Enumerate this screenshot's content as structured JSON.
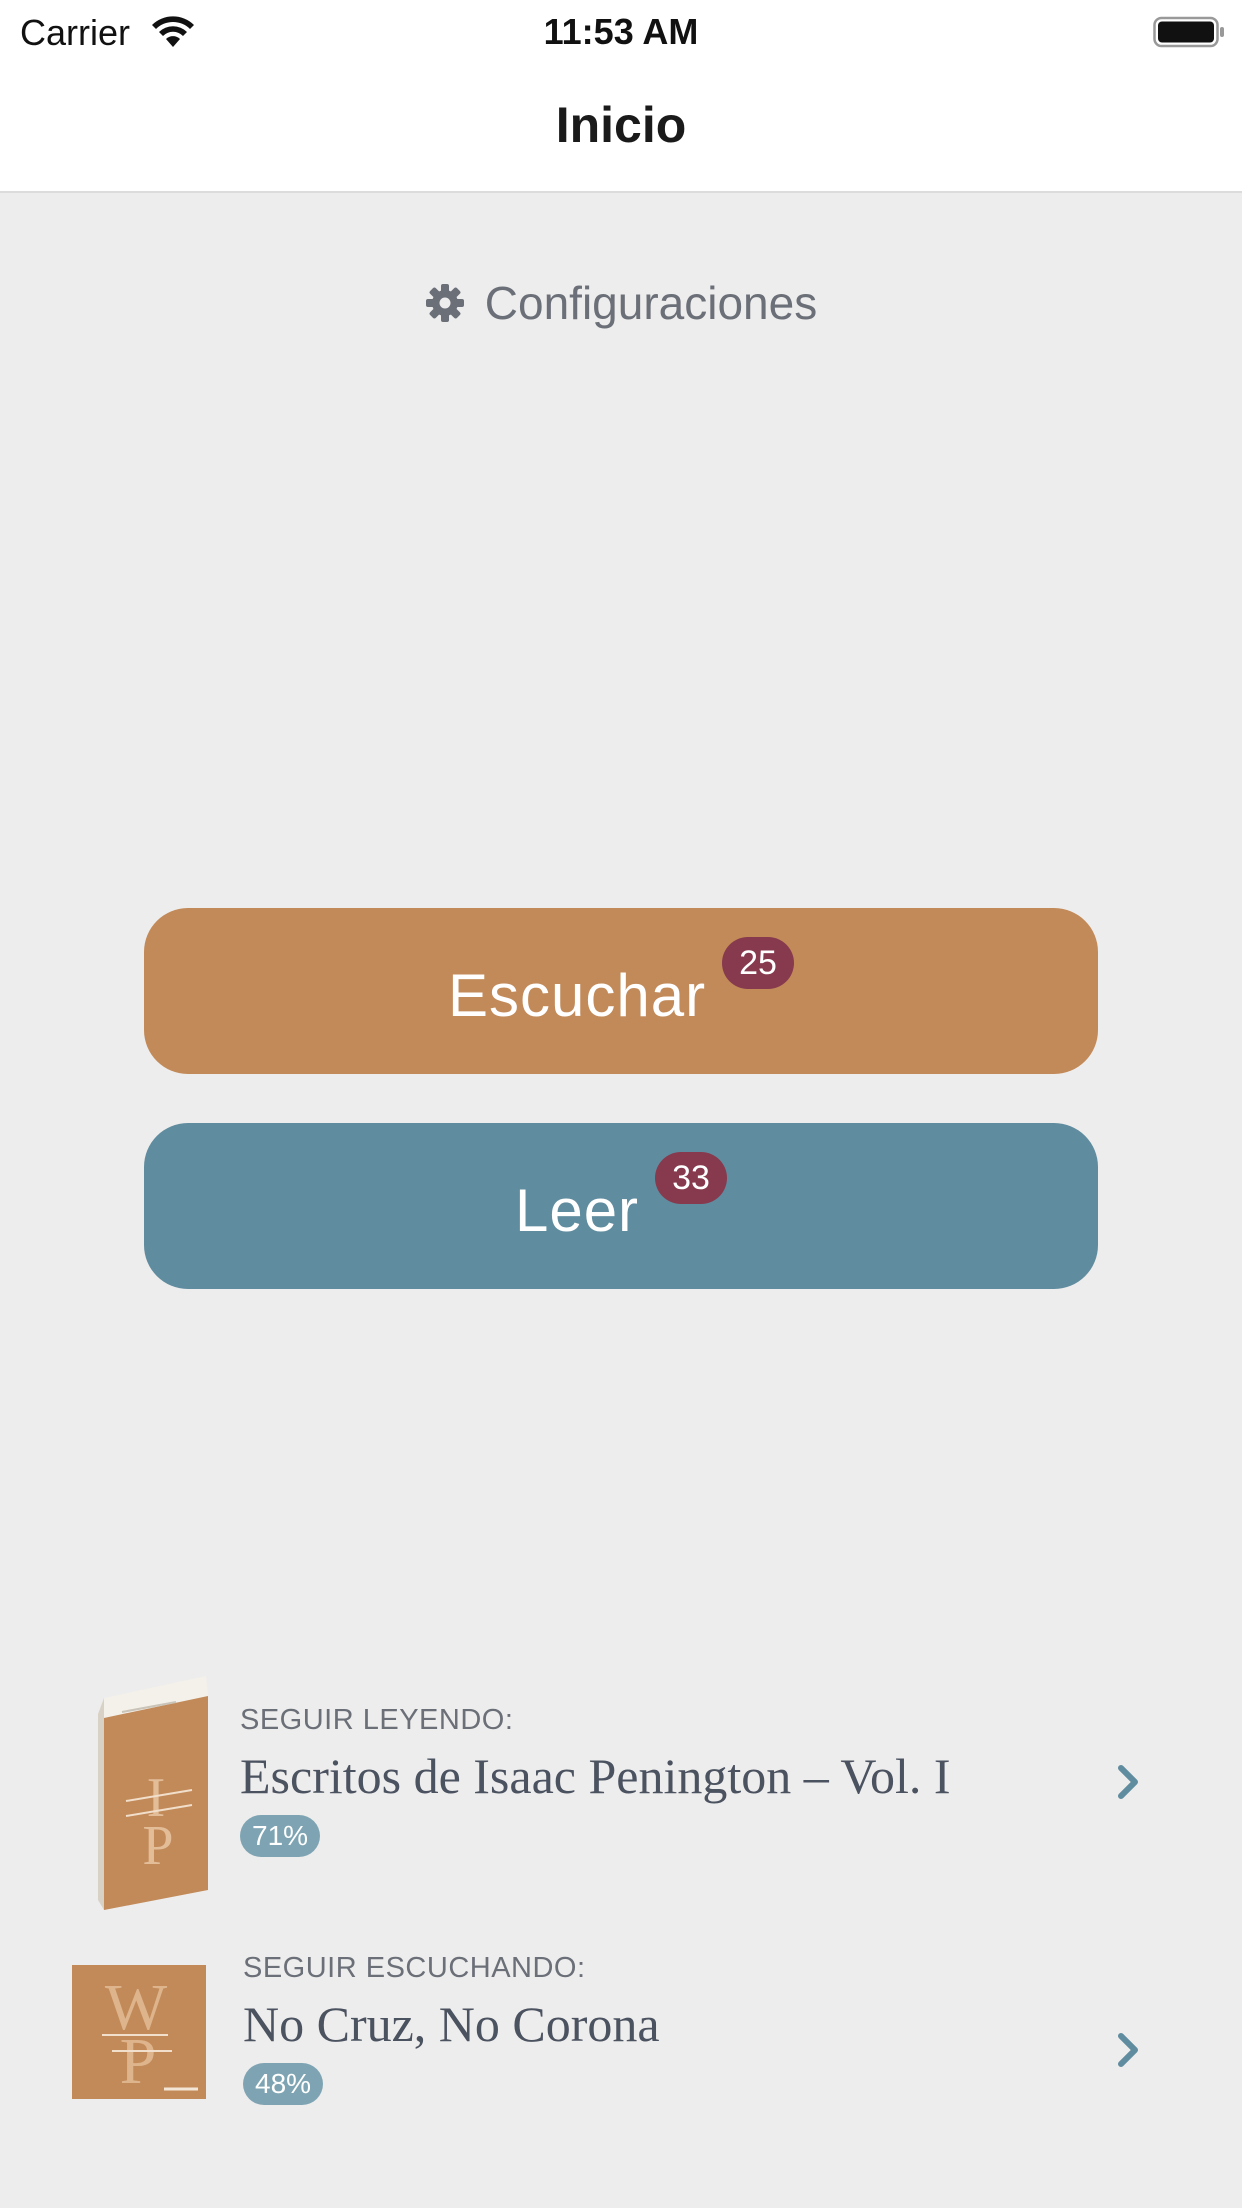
{
  "status_bar": {
    "carrier": "Carrier",
    "time": "11:53 AM"
  },
  "nav": {
    "title": "Inicio"
  },
  "settings": {
    "label": "Configuraciones",
    "icon": "gear-icon"
  },
  "actions": {
    "listen": {
      "label": "Escuchar",
      "badge": "25",
      "color": "#c28a59"
    },
    "read": {
      "label": "Leer",
      "badge": "33",
      "color": "#608c9f"
    },
    "badge_color": "#873a4d"
  },
  "continue_reading": {
    "caption": "SEGUIR LEYENDO:",
    "title": "Escritos de Isaac Penington – Vol. I",
    "progress": "71%",
    "cover_monogram_top": "I",
    "cover_monogram_bottom": "P"
  },
  "continue_listening": {
    "caption": "SEGUIR ESCUCHANDO:",
    "title": "No Cruz, No Corona",
    "progress": "48%",
    "cover_monogram_top": "W",
    "cover_monogram_bottom": "P"
  }
}
